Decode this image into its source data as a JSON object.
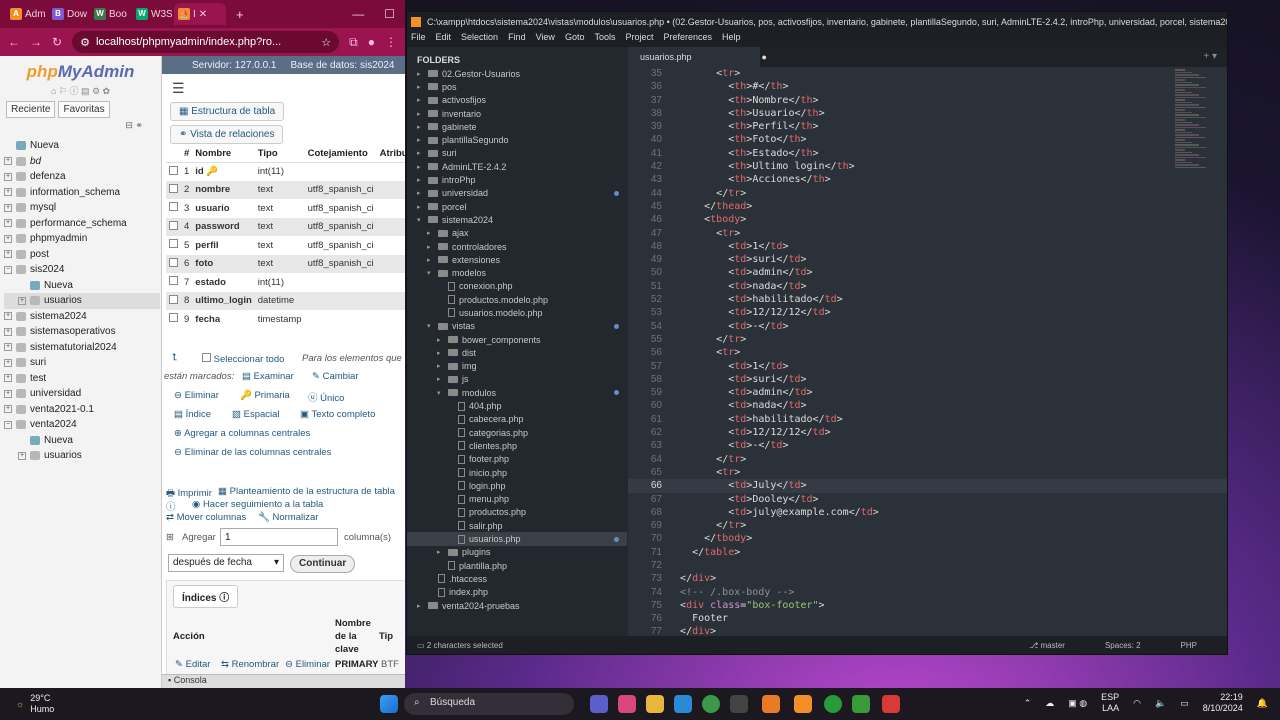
{
  "browser": {
    "tabs": [
      {
        "label": "Adm",
        "color": "#f28f2a",
        "glyph": "A"
      },
      {
        "label": "Dow",
        "color": "#7b5cd6",
        "glyph": "B"
      },
      {
        "label": "Boo",
        "color": "#3a7a4a",
        "glyph": "W"
      },
      {
        "label": "W3S",
        "color": "#04aa6d",
        "glyph": "W"
      }
    ],
    "active_tab": "I",
    "url": "localhost/phpmyadmin/index.php?ro..."
  },
  "pma": {
    "logo_php": "php",
    "logo_my": "MyAdmin",
    "left_btns": [
      "Reciente",
      "Favoritas"
    ],
    "tree": [
      {
        "label": "Nueva",
        "level": 0,
        "type": "new"
      },
      {
        "label": "bd",
        "level": 0
      },
      {
        "label": "defenza",
        "level": 0
      },
      {
        "label": "information_schema",
        "level": 0
      },
      {
        "label": "mysql",
        "level": 0
      },
      {
        "label": "performance_schema",
        "level": 0
      },
      {
        "label": "phpmyadmin",
        "level": 0
      },
      {
        "label": "post",
        "level": 0
      },
      {
        "label": "sis2024",
        "level": 0,
        "expanded": true
      },
      {
        "label": "Nueva",
        "level": 1,
        "type": "new"
      },
      {
        "label": "usuarios",
        "level": 1,
        "selected": true
      },
      {
        "label": "sistema2024",
        "level": 0
      },
      {
        "label": "sistemasoperativos",
        "level": 0
      },
      {
        "label": "sistematutorial2024",
        "level": 0
      },
      {
        "label": "suri",
        "level": 0
      },
      {
        "label": "test",
        "level": 0
      },
      {
        "label": "universidad",
        "level": 0
      },
      {
        "label": "venta2021-0.1",
        "level": 0
      },
      {
        "label": "venta2024",
        "level": 0,
        "expanded": true
      },
      {
        "label": "Nueva",
        "level": 1,
        "type": "new"
      },
      {
        "label": "usuarios",
        "level": 1
      }
    ],
    "crumb_server": "Servidor: 127.0.0.1",
    "crumb_db": "Base de datos: sis2024",
    "btn_struct": "Estructura de tabla",
    "btn_rel": "Vista de relaciones",
    "headers": [
      "#",
      "Nombre",
      "Tipo",
      "Cotejamiento",
      "Atribut"
    ],
    "rows": [
      {
        "n": "1",
        "name": "id",
        "type": "int(11)",
        "col": "",
        "key": true
      },
      {
        "n": "2",
        "name": "nombre",
        "type": "text",
        "col": "utf8_spanish_ci"
      },
      {
        "n": "3",
        "name": "usuario",
        "type": "text",
        "col": "utf8_spanish_ci"
      },
      {
        "n": "4",
        "name": "password",
        "type": "text",
        "col": "utf8_spanish_ci"
      },
      {
        "n": "5",
        "name": "perfil",
        "type": "text",
        "col": "utf8_spanish_ci"
      },
      {
        "n": "6",
        "name": "foto",
        "type": "text",
        "col": "utf8_spanish_ci"
      },
      {
        "n": "7",
        "name": "estado",
        "type": "int(11)",
        "col": ""
      },
      {
        "n": "8",
        "name": "ultimo_login",
        "type": "datetime",
        "col": ""
      },
      {
        "n": "9",
        "name": "fecha",
        "type": "timestamp",
        "col": ""
      }
    ],
    "select_all": "Seleccionar todo",
    "for_elements": "Para los elementos que",
    "marked": "están marcados:",
    "a_examinar": "Examinar",
    "a_cambiar": "Cambiar",
    "a_eliminar": "Eliminar",
    "a_primaria": "Primaria",
    "a_unico": "Único",
    "a_indice": "Índice",
    "a_espacial": "Espacial",
    "a_texto": "Texto completo",
    "a_agregar_cols": "Agregar a columnas centrales",
    "a_eliminar_cols": "Eliminar de las columnas centrales",
    "imprimir": "Imprimir",
    "planteamiento": "Planteamiento de la estructura de tabla",
    "seguimiento": "Hacer seguimiento a la tabla",
    "mover": "Mover columnas",
    "normalizar": "Normalizar",
    "agregar": "Agregar",
    "agregar_val": "1",
    "columnas": "columna(s)",
    "despues": "después de fecha",
    "continuar": "Continuar",
    "indices": "Índices",
    "idx_accion": "Acción",
    "idx_nombre": "Nombre de la clave",
    "idx_tipo": "Tip",
    "idx_editar": "Editar",
    "idx_renombrar": "Renombrar",
    "idx_eliminar": "Eliminar",
    "idx_primary": "PRIMARY",
    "idx_btf": "BTF",
    "consola": "Consola"
  },
  "sublime": {
    "title": "C:\\xampp\\htdocs\\sistema2024\\vistas\\modulos\\usuarios.php • (02.Gestor-Usuarios, pos, activosfijos, inventario, gabinete, plantillaSegundo, suri, AdminLTE-2.4.2, introPhp, universidad, porcel, sistema20...",
    "menu": [
      "File",
      "Edit",
      "Selection",
      "Find",
      "View",
      "Goto",
      "Tools",
      "Project",
      "Preferences",
      "Help"
    ],
    "folders_label": "FOLDERS",
    "files": [
      {
        "label": "02.Gestor-Usuarios",
        "d": 0,
        "k": "dir"
      },
      {
        "label": "pos",
        "d": 0,
        "k": "dir"
      },
      {
        "label": "activosfijos",
        "d": 0,
        "k": "dir"
      },
      {
        "label": "inventario",
        "d": 0,
        "k": "dir"
      },
      {
        "label": "gabinete",
        "d": 0,
        "k": "dir"
      },
      {
        "label": "plantillaSegundo",
        "d": 0,
        "k": "dir"
      },
      {
        "label": "suri",
        "d": 0,
        "k": "dir"
      },
      {
        "label": "AdminLTE-2.4.2",
        "d": 0,
        "k": "dir"
      },
      {
        "label": "introPhp",
        "d": 0,
        "k": "dir"
      },
      {
        "label": "universidad",
        "d": 0,
        "k": "dir",
        "dot": true
      },
      {
        "label": "porcel",
        "d": 0,
        "k": "dir"
      },
      {
        "label": "sistema2024",
        "d": 0,
        "k": "open"
      },
      {
        "label": "ajax",
        "d": 1,
        "k": "dir"
      },
      {
        "label": "controladores",
        "d": 1,
        "k": "dir"
      },
      {
        "label": "extensiones",
        "d": 1,
        "k": "dir"
      },
      {
        "label": "modelos",
        "d": 1,
        "k": "open"
      },
      {
        "label": "conexion.php",
        "d": 2,
        "k": "file"
      },
      {
        "label": "productos.modelo.php",
        "d": 2,
        "k": "file"
      },
      {
        "label": "usuarios.modelo.php",
        "d": 2,
        "k": "file"
      },
      {
        "label": "vistas",
        "d": 1,
        "k": "open",
        "dot": true
      },
      {
        "label": "bower_components",
        "d": 2,
        "k": "dir"
      },
      {
        "label": "dist",
        "d": 2,
        "k": "dir"
      },
      {
        "label": "img",
        "d": 2,
        "k": "dir"
      },
      {
        "label": "js",
        "d": 2,
        "k": "dir"
      },
      {
        "label": "modulos",
        "d": 2,
        "k": "open",
        "dot": true
      },
      {
        "label": "404.php",
        "d": 3,
        "k": "file"
      },
      {
        "label": "cabecera.php",
        "d": 3,
        "k": "file"
      },
      {
        "label": "categorias.php",
        "d": 3,
        "k": "file"
      },
      {
        "label": "clientes.php",
        "d": 3,
        "k": "file"
      },
      {
        "label": "footer.php",
        "d": 3,
        "k": "file"
      },
      {
        "label": "inicio.php",
        "d": 3,
        "k": "file"
      },
      {
        "label": "login.php",
        "d": 3,
        "k": "file"
      },
      {
        "label": "menu.php",
        "d": 3,
        "k": "file"
      },
      {
        "label": "productos.php",
        "d": 3,
        "k": "file"
      },
      {
        "label": "salir.php",
        "d": 3,
        "k": "file"
      },
      {
        "label": "usuarios.php",
        "d": 3,
        "k": "file",
        "sel": true,
        "dot": true
      },
      {
        "label": "plugins",
        "d": 2,
        "k": "dir"
      },
      {
        "label": "plantilla.php",
        "d": 2,
        "k": "file"
      },
      {
        "label": ".htaccess",
        "d": 1,
        "k": "file"
      },
      {
        "label": "index.php",
        "d": 1,
        "k": "file"
      },
      {
        "label": "venta2024-pruebas",
        "d": 0,
        "k": "dir"
      }
    ],
    "tab": "usuarios.php",
    "first_line": 35,
    "current_line": 66,
    "code": [
      "        <tr>",
      "          <th>#</th>",
      "          <th>Nombre</th>",
      "          <th>Usuario</th>",
      "          <th>Perfil</th>",
      "          <th>Foto</th>",
      "          <th>Estado</th>",
      "          <th>Ultimo login</th>",
      "          <th>Acciones</th>",
      "        </tr>",
      "      </thead>",
      "      <tbody>",
      "        <tr>",
      "          <td>1</td>",
      "          <td>suri</td>",
      "          <td>admin</td>",
      "          <td>nada</td>",
      "          <td>habilitado</td>",
      "          <td>12/12/12</td>",
      "          <td>-</td>",
      "        </tr>",
      "        <tr>",
      "          <td>1</td>",
      "          <td>suri</td>",
      "          <td>admin</td>",
      "          <td>nada</td>",
      "          <td>habilitado</td>",
      "          <td>12/12/12</td>",
      "          <td>-</td>",
      "        </tr>",
      "        <tr>",
      "          <td>July</td>",
      "          <td>Dooley</td>",
      "          <td>july@example.com</td>",
      "        </tr>",
      "      </tbody>",
      "    </table>",
      "",
      "  </div>",
      "  <!-- /.box-body -->",
      "  <div class=\"box-footer\">",
      "    Footer",
      "  </div>"
    ],
    "status_left": "2 characters selected",
    "status_branch": "master",
    "status_spaces": "Spaces: 2",
    "status_syntax": "PHP"
  },
  "taskbar": {
    "temp": "29°C",
    "weather": "Humo",
    "search": "Búsqueda",
    "lang1": "ESP",
    "lang2": "LAA",
    "time": "22:19",
    "date": "8/10/2024"
  }
}
